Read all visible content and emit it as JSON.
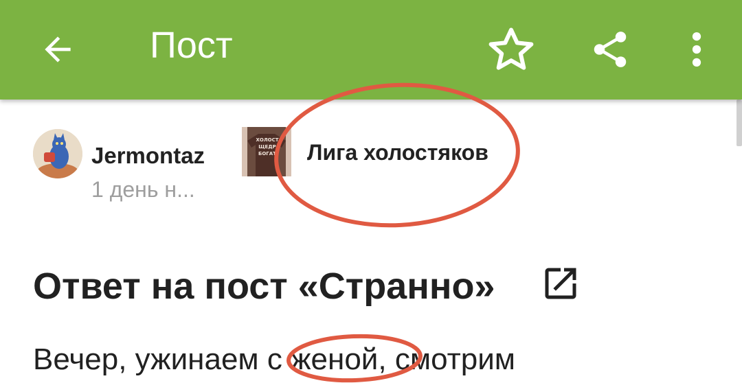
{
  "appbar": {
    "title": "Пост",
    "icons": [
      "arrow-left-icon",
      "star-outline-icon",
      "share-icon",
      "more-vertical-icon"
    ],
    "background_color": "#7cb342"
  },
  "post": {
    "author": "Jermontaz",
    "time": "1 день н...",
    "community": "Лига холостяков",
    "community_image_text": [
      "ХОЛОСТ",
      "ЩЕДР",
      "БОГАТ"
    ],
    "title": "Ответ на пост «Странно»",
    "body": "Вечер, ужинаем с женой, смотрим"
  },
  "annotation_color": "#e05a42"
}
